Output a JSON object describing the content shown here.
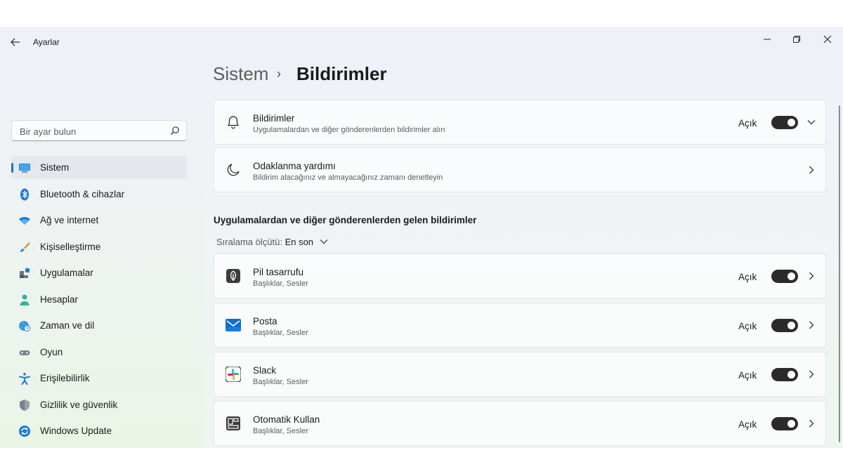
{
  "window": {
    "app_title": "Ayarlar",
    "controls": {
      "minimize": "─",
      "restore": "❐",
      "close": "✕"
    }
  },
  "search": {
    "placeholder": "Bir ayar bulun"
  },
  "sidebar": {
    "items": [
      {
        "label": "Sistem",
        "icon": "display-icon",
        "active": true
      },
      {
        "label": "Bluetooth & cihazlar",
        "icon": "bluetooth-icon"
      },
      {
        "label": "Ağ ve internet",
        "icon": "wifi-icon"
      },
      {
        "label": "Kişiselleştirme",
        "icon": "brush-icon"
      },
      {
        "label": "Uygulamalar",
        "icon": "apps-icon"
      },
      {
        "label": "Hesaplar",
        "icon": "person-icon"
      },
      {
        "label": "Zaman ve dil",
        "icon": "globe-clock-icon"
      },
      {
        "label": "Oyun",
        "icon": "gamepad-icon"
      },
      {
        "label": "Erişilebilirlik",
        "icon": "accessibility-icon"
      },
      {
        "label": "Gizlilik ve güvenlik",
        "icon": "shield-icon"
      },
      {
        "label": "Windows Update",
        "icon": "update-icon"
      }
    ]
  },
  "breadcrumb": {
    "parent": "Sistem",
    "separator": "›",
    "current": "Bildirimler"
  },
  "notifications_card": {
    "title": "Bildirimler",
    "subtitle": "Uygulamalardan ve diğer gönderenlerden bildirimler alın",
    "state": "Açık",
    "enabled": true
  },
  "focus_card": {
    "title": "Odaklanma yardımı",
    "subtitle": "Bildirim alacağınız ve almayacağınız zamanı denetleyin"
  },
  "senders": {
    "section_title": "Uygulamalardan ve diğer gönderenlerden gelen bildirimler",
    "sort_label": "Sıralama ölçütü:",
    "sort_value": "En son",
    "apps": [
      {
        "title": "Pil tasarrufu",
        "subtitle": "Başlıklar, Sesler",
        "state": "Açık",
        "enabled": true,
        "icon": "battery-saver-icon"
      },
      {
        "title": "Posta",
        "subtitle": "Başlıklar, Sesler",
        "state": "Açık",
        "enabled": true,
        "icon": "mail-icon"
      },
      {
        "title": "Slack",
        "subtitle": "Başlıklar, Sesler",
        "state": "Açık",
        "enabled": true,
        "icon": "slack-icon"
      },
      {
        "title": "Otomatik Kullan",
        "subtitle": "Başlıklar, Sesler",
        "state": "Açık",
        "enabled": true,
        "icon": "autoplay-icon"
      }
    ]
  },
  "colors": {
    "accent": "#1c6fcc",
    "toggle_on": "#2b2b2b"
  }
}
